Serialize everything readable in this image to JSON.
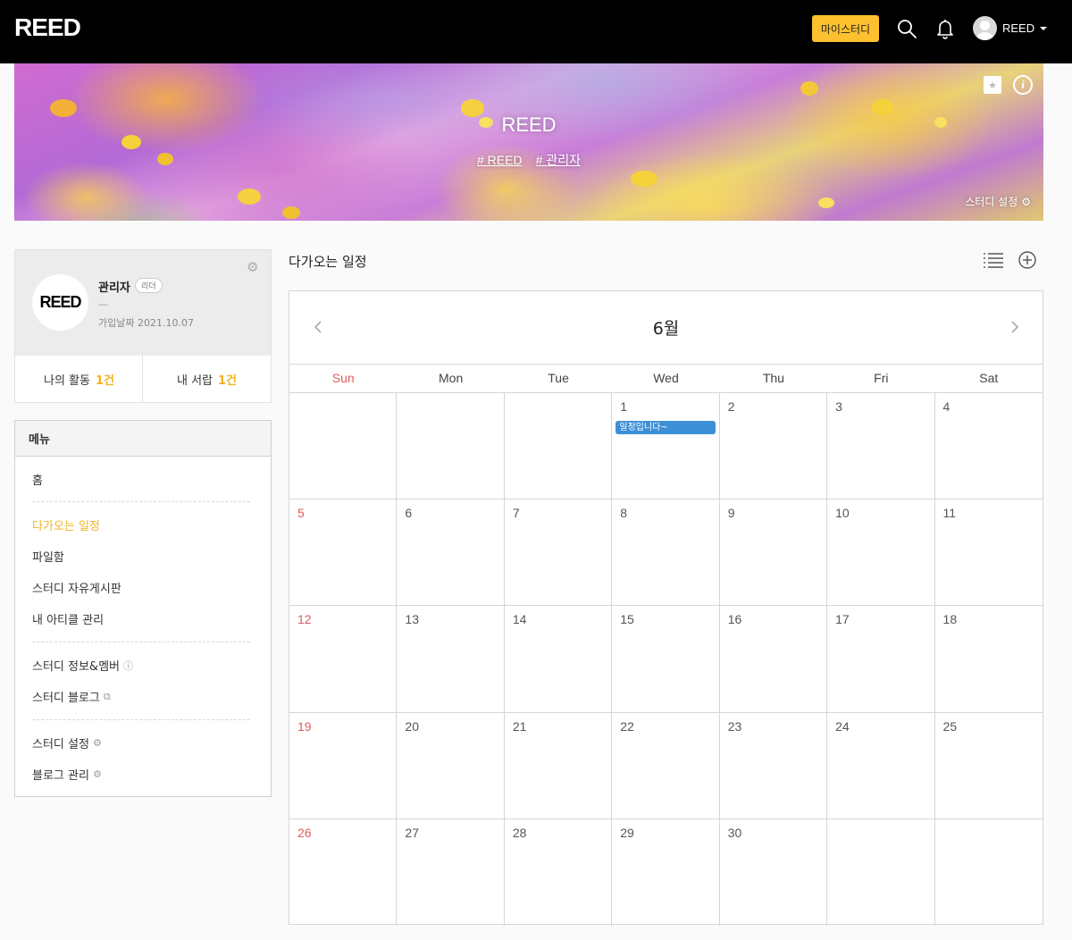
{
  "app": {
    "logo": "REED"
  },
  "topbar": {
    "mystudy_label": "마이스터디",
    "user_name": "REED",
    "icons": [
      "search-icon",
      "bell-icon",
      "avatar"
    ]
  },
  "banner": {
    "title": "REED",
    "tags": [
      "# REED",
      "# 관리자"
    ],
    "settings_label": "스터디 설정",
    "icons": [
      "star-icon",
      "info-icon",
      "gear-icon"
    ]
  },
  "profile": {
    "logo": "REED",
    "name": "관리자",
    "role_badge": "리더",
    "desc": "—",
    "joined": "가입날짜 2021.10.07",
    "stats": [
      {
        "label": "나의 활동",
        "count": "1건"
      },
      {
        "label": "내 서랍",
        "count": "1건"
      }
    ]
  },
  "menu": {
    "title": "메뉴",
    "items": [
      {
        "label": "홈"
      },
      {
        "label": "다가오는 일정",
        "active": true
      },
      {
        "label": "파일함"
      },
      {
        "label": "스터디 자유게시판"
      },
      {
        "label": "내 아티클 관리"
      },
      {
        "label": "스터디 정보&멤버",
        "icon": "info-icon"
      },
      {
        "label": "스터디 블로그",
        "icon": "external-link-icon"
      },
      {
        "label": "스터디 설정",
        "icon": "gear-icon"
      },
      {
        "label": "블로그 관리",
        "icon": "gear-icon"
      }
    ]
  },
  "schedule": {
    "title": "다가오는 일정",
    "month": "6월",
    "weekdays": [
      "Sun",
      "Mon",
      "Tue",
      "Wed",
      "Thu",
      "Fri",
      "Sat"
    ],
    "weeks": [
      [
        "",
        "",
        "",
        "1",
        "2",
        "3",
        "4"
      ],
      [
        "5",
        "6",
        "7",
        "8",
        "9",
        "10",
        "11"
      ],
      [
        "12",
        "13",
        "14",
        "15",
        "16",
        "17",
        "18"
      ],
      [
        "19",
        "20",
        "21",
        "22",
        "23",
        "24",
        "25"
      ],
      [
        "26",
        "27",
        "28",
        "29",
        "30",
        "",
        ""
      ]
    ],
    "events": [
      {
        "day": "1",
        "title": "일정입니다~"
      }
    ]
  },
  "colors": {
    "accent": "#fdc02f",
    "active_menu": "#f0b323",
    "sunday": "#e05c5c",
    "event": "#3d8fd6"
  }
}
